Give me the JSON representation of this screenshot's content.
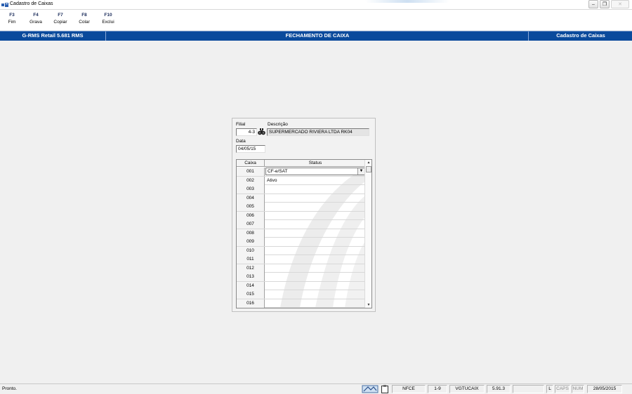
{
  "window": {
    "title": "Cadastro de Caixas",
    "controls": [
      "minimize",
      "restore",
      "close"
    ]
  },
  "toolbar": [
    {
      "key": "F3",
      "label": "Fim"
    },
    {
      "key": "F4",
      "label": "Grava"
    },
    {
      "key": "F7",
      "label": "Copiar"
    },
    {
      "key": "F8",
      "label": "Colar"
    },
    {
      "key": "F10",
      "label": "Exclui"
    }
  ],
  "header": {
    "left": "G-RMS Retail 5.681 RMS",
    "center": "FECHAMENTO DE CAIXA",
    "right": "Cadastro de Caixas"
  },
  "form": {
    "filial_label": "Filial",
    "filial_value": "4-3",
    "descricao_label": "Descrição",
    "descricao_value": "SUPERMERCADO RIVIERA LTDA RK04",
    "data_label": "Data",
    "data_value": "04/05/15"
  },
  "grid": {
    "columns": [
      "Caixa",
      "Status"
    ],
    "rows": [
      {
        "caixa": "001",
        "status": "CF-e/SAT"
      },
      {
        "caixa": "002",
        "status": "Ativo"
      },
      {
        "caixa": "003",
        "status": ""
      },
      {
        "caixa": "004",
        "status": ""
      },
      {
        "caixa": "005",
        "status": ""
      },
      {
        "caixa": "006",
        "status": ""
      },
      {
        "caixa": "007",
        "status": ""
      },
      {
        "caixa": "008",
        "status": ""
      },
      {
        "caixa": "009",
        "status": ""
      },
      {
        "caixa": "010",
        "status": ""
      },
      {
        "caixa": "011",
        "status": ""
      },
      {
        "caixa": "012",
        "status": ""
      },
      {
        "caixa": "013",
        "status": ""
      },
      {
        "caixa": "014",
        "status": ""
      },
      {
        "caixa": "015",
        "status": ""
      },
      {
        "caixa": "016",
        "status": ""
      }
    ]
  },
  "statusbar": {
    "message": "Pronto.",
    "panels": [
      "NFCE",
      "1-9",
      "VGTUCAIX",
      "5.91.3",
      "",
      "L",
      "CAPS",
      "NUM",
      "28/05/2015"
    ]
  },
  "colors": {
    "header_bg": "#0a4a9c",
    "toolbar_key": "#1a2b5a",
    "window_bg": "#f0f0f0"
  }
}
